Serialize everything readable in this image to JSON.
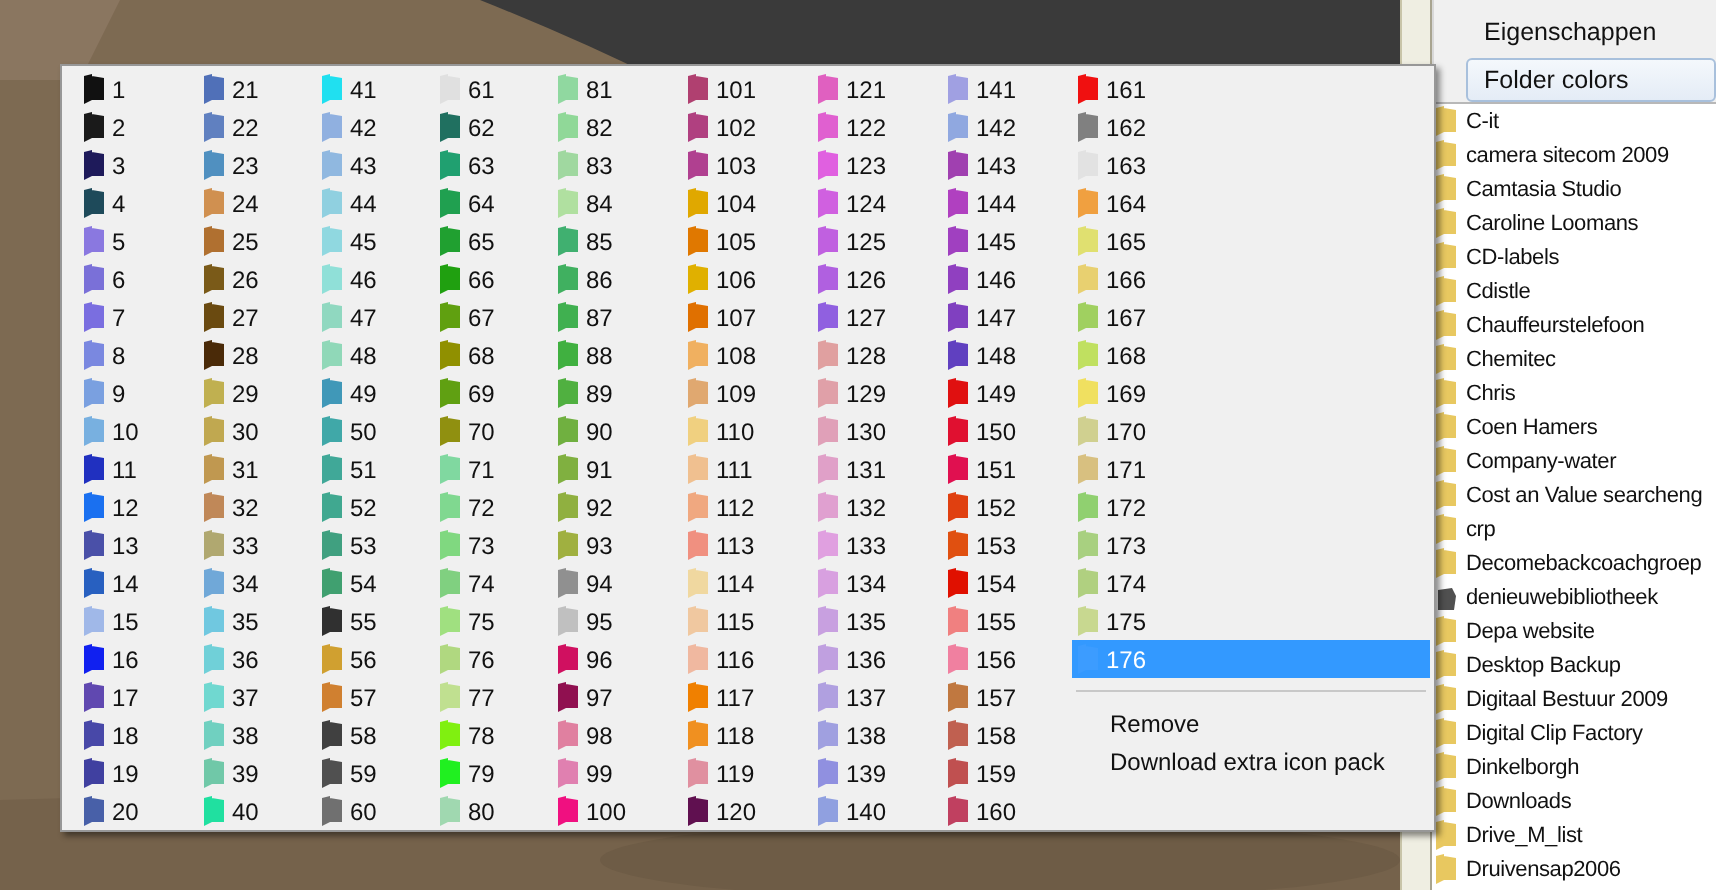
{
  "folder_colors_menu": {
    "colors": [
      {
        "label": "1",
        "color": "#111111",
        "selected": false
      },
      {
        "label": "2",
        "color": "#1a1a1a",
        "selected": false
      },
      {
        "label": "3",
        "color": "#1e1a5a",
        "selected": false
      },
      {
        "label": "4",
        "color": "#1e4a5a",
        "selected": false
      },
      {
        "label": "5",
        "color": "#8a78e0",
        "selected": false
      },
      {
        "label": "6",
        "color": "#7a70d8",
        "selected": false
      },
      {
        "label": "7",
        "color": "#7a6ee0",
        "selected": false
      },
      {
        "label": "8",
        "color": "#7a88e0",
        "selected": false
      },
      {
        "label": "9",
        "color": "#7aa0e0",
        "selected": false
      },
      {
        "label": "10",
        "color": "#78b0e0",
        "selected": false
      },
      {
        "label": "11",
        "color": "#2030c0",
        "selected": false
      },
      {
        "label": "12",
        "color": "#1a70f0",
        "selected": false
      },
      {
        "label": "13",
        "color": "#4a50a8",
        "selected": false
      },
      {
        "label": "14",
        "color": "#2860c0",
        "selected": false
      },
      {
        "label": "15",
        "color": "#a0b8e8",
        "selected": false
      },
      {
        "label": "16",
        "color": "#1020f0",
        "selected": false
      },
      {
        "label": "17",
        "color": "#6048b0",
        "selected": false
      },
      {
        "label": "18",
        "color": "#4848a8",
        "selected": false
      },
      {
        "label": "19",
        "color": "#4040a0",
        "selected": false
      },
      {
        "label": "20",
        "color": "#4860a8",
        "selected": false
      },
      {
        "label": "21",
        "color": "#5070b8",
        "selected": false
      },
      {
        "label": "22",
        "color": "#6080c0",
        "selected": false
      },
      {
        "label": "23",
        "color": "#5090c0",
        "selected": false
      },
      {
        "label": "24",
        "color": "#d09050",
        "selected": false
      },
      {
        "label": "25",
        "color": "#b07030",
        "selected": false
      },
      {
        "label": "26",
        "color": "#7a5a18",
        "selected": false
      },
      {
        "label": "27",
        "color": "#6a4a10",
        "selected": false
      },
      {
        "label": "28",
        "color": "#4a2a08",
        "selected": false
      },
      {
        "label": "29",
        "color": "#c0b050",
        "selected": false
      },
      {
        "label": "30",
        "color": "#c0a850",
        "selected": false
      },
      {
        "label": "31",
        "color": "#c09850",
        "selected": false
      },
      {
        "label": "32",
        "color": "#c08858",
        "selected": false
      },
      {
        "label": "33",
        "color": "#b0a870",
        "selected": false
      },
      {
        "label": "34",
        "color": "#70a8d8",
        "selected": false
      },
      {
        "label": "35",
        "color": "#70c8e0",
        "selected": false
      },
      {
        "label": "36",
        "color": "#70d0d8",
        "selected": false
      },
      {
        "label": "37",
        "color": "#70d8d0",
        "selected": false
      },
      {
        "label": "38",
        "color": "#70d0c0",
        "selected": false
      },
      {
        "label": "39",
        "color": "#70c8a8",
        "selected": false
      },
      {
        "label": "40",
        "color": "#20e0a0",
        "selected": false
      },
      {
        "label": "41",
        "color": "#20e0f0",
        "selected": false
      },
      {
        "label": "42",
        "color": "#90b0e0",
        "selected": false
      },
      {
        "label": "43",
        "color": "#90b8e0",
        "selected": false
      },
      {
        "label": "44",
        "color": "#90d0e0",
        "selected": false
      },
      {
        "label": "45",
        "color": "#90d8e0",
        "selected": false
      },
      {
        "label": "46",
        "color": "#90e0d8",
        "selected": false
      },
      {
        "label": "47",
        "color": "#90d8c0",
        "selected": false
      },
      {
        "label": "48",
        "color": "#90d8b8",
        "selected": false
      },
      {
        "label": "49",
        "color": "#4098b8",
        "selected": false
      },
      {
        "label": "50",
        "color": "#40a8a8",
        "selected": false
      },
      {
        "label": "51",
        "color": "#40a898",
        "selected": false
      },
      {
        "label": "52",
        "color": "#40a890",
        "selected": false
      },
      {
        "label": "53",
        "color": "#40a080",
        "selected": false
      },
      {
        "label": "54",
        "color": "#40a070",
        "selected": false
      },
      {
        "label": "55",
        "color": "#303030",
        "selected": false
      },
      {
        "label": "56",
        "color": "#d0a030",
        "selected": false
      },
      {
        "label": "57",
        "color": "#d08030",
        "selected": false
      },
      {
        "label": "58",
        "color": "#404040",
        "selected": false
      },
      {
        "label": "59",
        "color": "#505050",
        "selected": false
      },
      {
        "label": "60",
        "color": "#707070",
        "selected": false
      },
      {
        "label": "61",
        "color": "#e0e0e0",
        "selected": false
      },
      {
        "label": "62",
        "color": "#207060",
        "selected": false
      },
      {
        "label": "63",
        "color": "#20a070",
        "selected": false
      },
      {
        "label": "64",
        "color": "#20a050",
        "selected": false
      },
      {
        "label": "65",
        "color": "#20a030",
        "selected": false
      },
      {
        "label": "66",
        "color": "#20a010",
        "selected": false
      },
      {
        "label": "67",
        "color": "#60a010",
        "selected": false
      },
      {
        "label": "68",
        "color": "#909000",
        "selected": false
      },
      {
        "label": "69",
        "color": "#60a012",
        "selected": false
      },
      {
        "label": "70",
        "color": "#909010",
        "selected": false
      },
      {
        "label": "71",
        "color": "#80d8a0",
        "selected": false
      },
      {
        "label": "72",
        "color": "#80d890",
        "selected": false
      },
      {
        "label": "73",
        "color": "#80d880",
        "selected": false
      },
      {
        "label": "74",
        "color": "#80d080",
        "selected": false
      },
      {
        "label": "75",
        "color": "#a0e080",
        "selected": false
      },
      {
        "label": "76",
        "color": "#b0d880",
        "selected": false
      },
      {
        "label": "77",
        "color": "#c0e090",
        "selected": false
      },
      {
        "label": "78",
        "color": "#80f010",
        "selected": false
      },
      {
        "label": "79",
        "color": "#20f020",
        "selected": false
      },
      {
        "label": "80",
        "color": "#a0d8b0",
        "selected": false
      },
      {
        "label": "81",
        "color": "#90d8a0",
        "selected": false
      },
      {
        "label": "82",
        "color": "#90d898",
        "selected": false
      },
      {
        "label": "83",
        "color": "#a0d8a0",
        "selected": false
      },
      {
        "label": "84",
        "color": "#b0e0a0",
        "selected": false
      },
      {
        "label": "85",
        "color": "#40b070",
        "selected": false
      },
      {
        "label": "86",
        "color": "#40b060",
        "selected": false
      },
      {
        "label": "87",
        "color": "#40b050",
        "selected": false
      },
      {
        "label": "88",
        "color": "#40b040",
        "selected": false
      },
      {
        "label": "89",
        "color": "#50b040",
        "selected": false
      },
      {
        "label": "90",
        "color": "#70b040",
        "selected": false
      },
      {
        "label": "91",
        "color": "#80b040",
        "selected": false
      },
      {
        "label": "92",
        "color": "#90b040",
        "selected": false
      },
      {
        "label": "93",
        "color": "#a0b040",
        "selected": false
      },
      {
        "label": "94",
        "color": "#909090",
        "selected": false
      },
      {
        "label": "95",
        "color": "#c0c0c0",
        "selected": false
      },
      {
        "label": "96",
        "color": "#d01060",
        "selected": false
      },
      {
        "label": "97",
        "color": "#901050",
        "selected": false
      },
      {
        "label": "98",
        "color": "#e080a0",
        "selected": false
      },
      {
        "label": "99",
        "color": "#e080b0",
        "selected": false
      },
      {
        "label": "100",
        "color": "#f01080",
        "selected": false
      },
      {
        "label": "101",
        "color": "#b04070",
        "selected": false
      },
      {
        "label": "102",
        "color": "#b04080",
        "selected": false
      },
      {
        "label": "103",
        "color": "#b04090",
        "selected": false
      },
      {
        "label": "104",
        "color": "#e0a800",
        "selected": false
      },
      {
        "label": "105",
        "color": "#e07800",
        "selected": false
      },
      {
        "label": "106",
        "color": "#e0b000",
        "selected": false
      },
      {
        "label": "107",
        "color": "#e07000",
        "selected": false
      },
      {
        "label": "108",
        "color": "#f0b060",
        "selected": false
      },
      {
        "label": "109",
        "color": "#e0a870",
        "selected": false
      },
      {
        "label": "110",
        "color": "#f0d080",
        "selected": false
      },
      {
        "label": "111",
        "color": "#f0c090",
        "selected": false
      },
      {
        "label": "112",
        "color": "#f0a880",
        "selected": false
      },
      {
        "label": "113",
        "color": "#f09080",
        "selected": false
      },
      {
        "label": "114",
        "color": "#f0d8a0",
        "selected": false
      },
      {
        "label": "115",
        "color": "#f0c8a0",
        "selected": false
      },
      {
        "label": "116",
        "color": "#f0b8a0",
        "selected": false
      },
      {
        "label": "117",
        "color": "#f08000",
        "selected": false
      },
      {
        "label": "118",
        "color": "#f09020",
        "selected": false
      },
      {
        "label": "119",
        "color": "#e090a0",
        "selected": false
      },
      {
        "label": "120",
        "color": "#601050",
        "selected": false
      },
      {
        "label": "121",
        "color": "#e060c0",
        "selected": false
      },
      {
        "label": "122",
        "color": "#e060d0",
        "selected": false
      },
      {
        "label": "123",
        "color": "#e060e0",
        "selected": false
      },
      {
        "label": "124",
        "color": "#d060e0",
        "selected": false
      },
      {
        "label": "125",
        "color": "#c060e0",
        "selected": false
      },
      {
        "label": "126",
        "color": "#b060e0",
        "selected": false
      },
      {
        "label": "127",
        "color": "#9060e0",
        "selected": false
      },
      {
        "label": "128",
        "color": "#e0a0a0",
        "selected": false
      },
      {
        "label": "129",
        "color": "#e0a0a8",
        "selected": false
      },
      {
        "label": "130",
        "color": "#e0a0b8",
        "selected": false
      },
      {
        "label": "131",
        "color": "#e0a0c8",
        "selected": false
      },
      {
        "label": "132",
        "color": "#e0a0d0",
        "selected": false
      },
      {
        "label": "133",
        "color": "#e0a0e0",
        "selected": false
      },
      {
        "label": "134",
        "color": "#d8a0e0",
        "selected": false
      },
      {
        "label": "135",
        "color": "#c8a0e0",
        "selected": false
      },
      {
        "label": "136",
        "color": "#c0a0e0",
        "selected": false
      },
      {
        "label": "137",
        "color": "#b0a0e0",
        "selected": false
      },
      {
        "label": "138",
        "color": "#a0a0e0",
        "selected": false
      },
      {
        "label": "139",
        "color": "#9090e0",
        "selected": false
      },
      {
        "label": "140",
        "color": "#90a0e0",
        "selected": false
      },
      {
        "label": "141",
        "color": "#a0a0e2",
        "selected": false
      },
      {
        "label": "142",
        "color": "#90a8e0",
        "selected": false
      },
      {
        "label": "143",
        "color": "#a040b0",
        "selected": false
      },
      {
        "label": "144",
        "color": "#b040c0",
        "selected": false
      },
      {
        "label": "145",
        "color": "#a040c0",
        "selected": false
      },
      {
        "label": "146",
        "color": "#9040c0",
        "selected": false
      },
      {
        "label": "147",
        "color": "#8040c0",
        "selected": false
      },
      {
        "label": "148",
        "color": "#6040c0",
        "selected": false
      },
      {
        "label": "149",
        "color": "#e01010",
        "selected": false
      },
      {
        "label": "150",
        "color": "#e01030",
        "selected": false
      },
      {
        "label": "151",
        "color": "#e01050",
        "selected": false
      },
      {
        "label": "152",
        "color": "#e04010",
        "selected": false
      },
      {
        "label": "153",
        "color": "#e05010",
        "selected": false
      },
      {
        "label": "154",
        "color": "#e01000",
        "selected": false
      },
      {
        "label": "155",
        "color": "#f08080",
        "selected": false
      },
      {
        "label": "156",
        "color": "#f080a0",
        "selected": false
      },
      {
        "label": "157",
        "color": "#c07840",
        "selected": false
      },
      {
        "label": "158",
        "color": "#c06050",
        "selected": false
      },
      {
        "label": "159",
        "color": "#c05050",
        "selected": false
      },
      {
        "label": "160",
        "color": "#c04060",
        "selected": false
      },
      {
        "label": "161",
        "color": "#f01010",
        "selected": false
      },
      {
        "label": "162",
        "color": "#808080",
        "selected": false
      },
      {
        "label": "163",
        "color": "#e2e2e2",
        "selected": false
      },
      {
        "label": "164",
        "color": "#f0a040",
        "selected": false
      },
      {
        "label": "165",
        "color": "#e0e070",
        "selected": false
      },
      {
        "label": "166",
        "color": "#e8d070",
        "selected": false
      },
      {
        "label": "167",
        "color": "#a0d060",
        "selected": false
      },
      {
        "label": "168",
        "color": "#c0e060",
        "selected": false
      },
      {
        "label": "169",
        "color": "#f0e060",
        "selected": false
      },
      {
        "label": "170",
        "color": "#d0d090",
        "selected": false
      },
      {
        "label": "171",
        "color": "#d8c080",
        "selected": false
      },
      {
        "label": "172",
        "color": "#90d070",
        "selected": false
      },
      {
        "label": "173",
        "color": "#a8d080",
        "selected": false
      },
      {
        "label": "174",
        "color": "#b0d080",
        "selected": false
      },
      {
        "label": "175",
        "color": "#c8d890",
        "selected": false
      },
      {
        "label": "176",
        "color": "#3c9cff",
        "selected": true
      }
    ],
    "actions": [
      "Remove",
      "Download extra icon pack"
    ]
  },
  "context_menu": {
    "items": [
      {
        "label": "Eigenschappen",
        "selected": false
      },
      {
        "label": "Folder colors",
        "selected": true
      }
    ]
  },
  "file_list": {
    "items": [
      {
        "name": "C-it",
        "kind": "folder"
      },
      {
        "name": "camera sitecom 2009",
        "kind": "folder"
      },
      {
        "name": "Camtasia Studio",
        "kind": "folder"
      },
      {
        "name": "Caroline Loomans",
        "kind": "folder"
      },
      {
        "name": "CD-labels",
        "kind": "folder"
      },
      {
        "name": "Cdistle",
        "kind": "folder"
      },
      {
        "name": "Chauffeurstelefoon",
        "kind": "folder"
      },
      {
        "name": "Chemitec",
        "kind": "folder"
      },
      {
        "name": "Chris",
        "kind": "folder"
      },
      {
        "name": "Coen Hamers",
        "kind": "folder"
      },
      {
        "name": "Company-water",
        "kind": "folder"
      },
      {
        "name": "Cost an Value searcheng",
        "kind": "folder"
      },
      {
        "name": "crp",
        "kind": "folder"
      },
      {
        "name": "Decomebackcoachgroep",
        "kind": "folder"
      },
      {
        "name": "denieuwebibliotheek",
        "kind": "file"
      },
      {
        "name": "Depa website",
        "kind": "folder"
      },
      {
        "name": "Desktop Backup",
        "kind": "folder"
      },
      {
        "name": "Digitaal Bestuur 2009",
        "kind": "folder"
      },
      {
        "name": "Digital Clip Factory",
        "kind": "folder"
      },
      {
        "name": "Dinkelborgh",
        "kind": "folder"
      },
      {
        "name": "Downloads",
        "kind": "folder"
      },
      {
        "name": "Drive_M_list",
        "kind": "folder"
      },
      {
        "name": "Druivensap2006",
        "kind": "folder"
      }
    ]
  }
}
